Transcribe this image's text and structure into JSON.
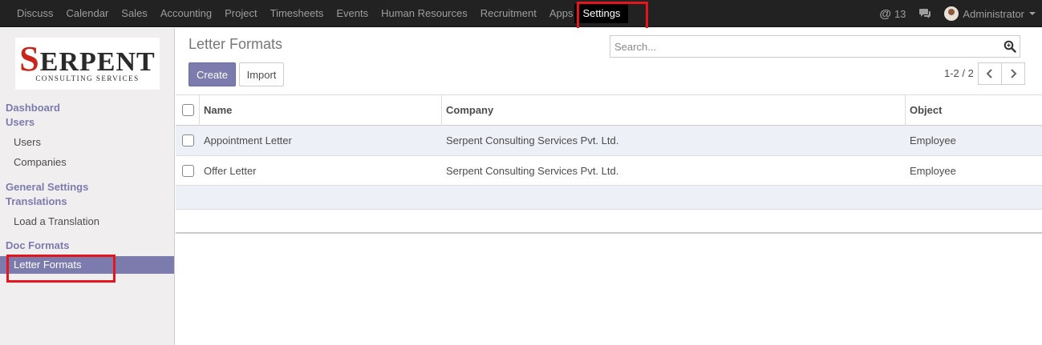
{
  "topbar": {
    "menu": [
      {
        "label": "Discuss"
      },
      {
        "label": "Calendar"
      },
      {
        "label": "Sales"
      },
      {
        "label": "Accounting"
      },
      {
        "label": "Project"
      },
      {
        "label": "Timesheets"
      },
      {
        "label": "Events"
      },
      {
        "label": "Human Resources"
      },
      {
        "label": "Recruitment"
      },
      {
        "label": "Apps"
      }
    ],
    "active_menu": "Settings",
    "mention_count": "13",
    "user_name": "Administrator"
  },
  "logo": {
    "big": "ERPENT",
    "s": "S",
    "small": "CONSULTING SERVICES"
  },
  "sidebar": {
    "dashboard": "Dashboard",
    "users_head": "Users",
    "users": "Users",
    "companies": "Companies",
    "general_settings": "General Settings",
    "translations_head": "Translations",
    "load_translation": "Load a Translation",
    "doc_formats": "Doc Formats",
    "letter_formats": "Letter Formats"
  },
  "main": {
    "title": "Letter Formats",
    "create_label": "Create",
    "import_label": "Import",
    "search_placeholder": "Search...",
    "pager": "1-2 / 2"
  },
  "table": {
    "headers": {
      "name": "Name",
      "company": "Company",
      "object": "Object"
    },
    "rows": [
      {
        "name": "Appointment Letter",
        "company": "Serpent Consulting Services Pvt. Ltd.",
        "object": "Employee"
      },
      {
        "name": "Offer Letter",
        "company": "Serpent Consulting Services Pvt. Ltd.",
        "object": "Employee"
      }
    ]
  },
  "colors": {
    "accent": "#7c7bad",
    "highlight_box": "#e6141b",
    "topbar": "#222222"
  }
}
